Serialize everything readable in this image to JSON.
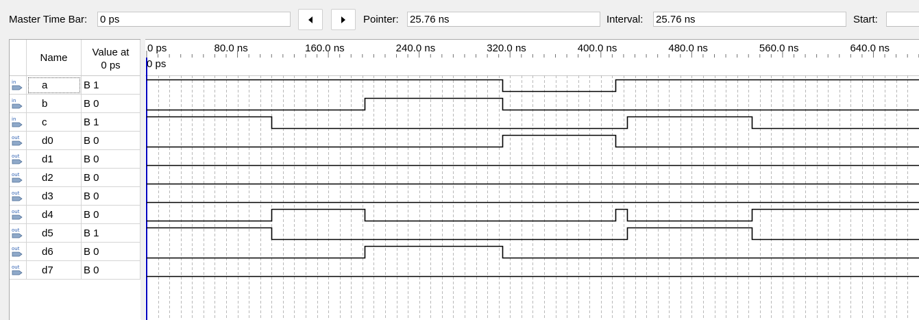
{
  "toolbar": {
    "master_time_bar_label": "Master Time Bar:",
    "master_time_bar_value": "0 ps",
    "prev_button_icon": "triangle-left-icon",
    "next_button_icon": "triangle-right-icon",
    "pointer_label": "Pointer:",
    "pointer_value": "25.76 ns",
    "interval_label": "Interval:",
    "interval_value": "25.76 ns",
    "start_label": "Start:",
    "start_value": ""
  },
  "grid": {
    "name_header": "Name",
    "value_header_line1": "Value at",
    "value_header_line2": "0 ps",
    "signals": [
      {
        "pin": "in",
        "name": "a",
        "value": "B 1"
      },
      {
        "pin": "in",
        "name": "b",
        "value": "B 0"
      },
      {
        "pin": "in",
        "name": "c",
        "value": "B 1"
      },
      {
        "pin": "out",
        "name": "d0",
        "value": "B 0"
      },
      {
        "pin": "out",
        "name": "d1",
        "value": "B 0"
      },
      {
        "pin": "out",
        "name": "d2",
        "value": "B 0"
      },
      {
        "pin": "out",
        "name": "d3",
        "value": "B 0"
      },
      {
        "pin": "out",
        "name": "d4",
        "value": "B 0"
      },
      {
        "pin": "out",
        "name": "d5",
        "value": "B 1"
      },
      {
        "pin": "out",
        "name": "d6",
        "value": "B 0"
      },
      {
        "pin": "out",
        "name": "d7",
        "value": "B 0"
      }
    ]
  },
  "waveform": {
    "ruler_labels": [
      "0 ps",
      "80.0 ns",
      "160.0 ns",
      "240.0 ns",
      "320.0 ns",
      "400.0 ns",
      "480.0 ns",
      "560.0 ns",
      "640.0 ns"
    ],
    "ruler_step_ns": 80,
    "visible_range_ns": [
      0,
      680
    ],
    "minor_grid_ns": 10,
    "cursor_label": "0 ps",
    "colors": {
      "trace": "#000000",
      "grid": "#b8b8b8",
      "cursor": "#0000c0"
    },
    "traces": [
      {
        "name": "a",
        "initial": 1,
        "transitions_ns": [
          313,
          413
        ]
      },
      {
        "name": "b",
        "initial": 0,
        "transitions_ns": [
          192,
          313
        ]
      },
      {
        "name": "c",
        "initial": 1,
        "transitions_ns": [
          110,
          423,
          533
        ]
      },
      {
        "name": "d0",
        "initial": 0,
        "transitions_ns": [
          313,
          413
        ]
      },
      {
        "name": "d1",
        "initial": 0,
        "transitions_ns": []
      },
      {
        "name": "d2",
        "initial": 0,
        "transitions_ns": []
      },
      {
        "name": "d3",
        "initial": 0,
        "transitions_ns": []
      },
      {
        "name": "d4",
        "initial": 0,
        "transitions_ns": [
          110,
          192,
          413,
          423,
          533
        ]
      },
      {
        "name": "d5",
        "initial": 1,
        "transitions_ns": [
          110,
          423,
          533
        ]
      },
      {
        "name": "d6",
        "initial": 0,
        "transitions_ns": [
          192,
          313
        ]
      },
      {
        "name": "d7",
        "initial": 0,
        "transitions_ns": []
      }
    ]
  }
}
